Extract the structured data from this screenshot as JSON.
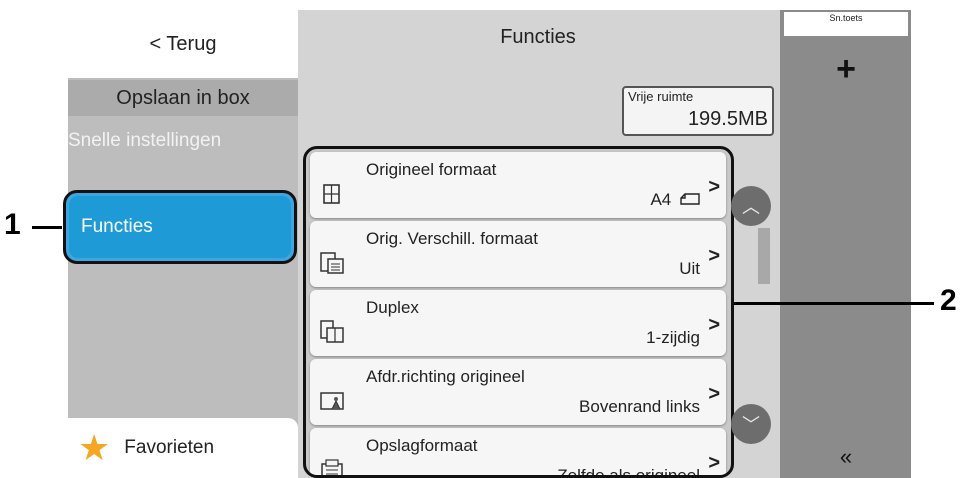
{
  "header": {
    "back_label": "< Terug",
    "title": "Functies"
  },
  "sidebar": {
    "section_title": "Opslaan in box",
    "items": [
      {
        "label": "Snelle instellingen"
      },
      {
        "label": "Functies",
        "selected": true
      }
    ],
    "favorites": {
      "label": "Favorieten",
      "icon": "star-icon"
    }
  },
  "storage": {
    "label": "Vrije ruimte",
    "value": "199.5MB"
  },
  "shortcut": {
    "tab_label": "Sn.toets",
    "add_icon": "plus-icon",
    "collapse_icon": "double-chevron-left-icon"
  },
  "functions": [
    {
      "title": "Origineel formaat",
      "value": "A4",
      "icon": "original-size-icon"
    },
    {
      "title": "Orig. Verschill. formaat",
      "value": "Uit",
      "icon": "mixed-size-icon"
    },
    {
      "title": "Duplex",
      "value": "1-zijdig",
      "icon": "duplex-icon"
    },
    {
      "title": "Afdr.richting origineel",
      "value": "Bovenrand links",
      "icon": "orientation-icon"
    },
    {
      "title": "Opslagformaat",
      "value": "Zelfde als origineel",
      "icon": "storage-size-icon"
    }
  ],
  "callouts": {
    "left": "1",
    "right": "2"
  },
  "colors": {
    "selected": "#1e9ad6",
    "favorite_star": "#f5a623"
  }
}
